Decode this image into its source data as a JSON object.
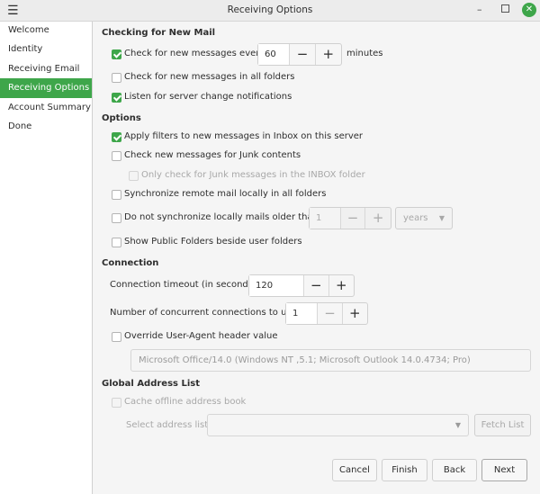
{
  "window": {
    "title": "Receiving Options",
    "close_color": "#3ea64a"
  },
  "sidebar": {
    "items": [
      {
        "label": "Welcome"
      },
      {
        "label": "Identity"
      },
      {
        "label": "Receiving Email"
      },
      {
        "label": "Receiving Options",
        "selected": true
      },
      {
        "label": "Account Summary"
      },
      {
        "label": "Done"
      }
    ]
  },
  "checking": {
    "heading": "Checking for New Mail",
    "every": {
      "label": "Check for new messages every",
      "checked": true,
      "value": "60",
      "unit": "minutes"
    },
    "all_folders": {
      "label": "Check for new messages in all folders",
      "checked": false
    },
    "listen": {
      "label": "Listen for server change notifications",
      "checked": true
    }
  },
  "options": {
    "heading": "Options",
    "filters": {
      "label": "Apply filters to new messages in Inbox on this server",
      "checked": true
    },
    "junk": {
      "label": "Check new messages for Junk contents",
      "checked": false
    },
    "junk_inbox": {
      "label": "Only check for Junk messages in the INBOX folder",
      "checked": false
    },
    "sync": {
      "label": "Synchronize remote mail locally in all folders",
      "checked": false
    },
    "nosync": {
      "label": "Do not synchronize locally mails older than",
      "checked": false,
      "value": "1",
      "unit": "years"
    },
    "public": {
      "label": "Show Public Folders beside user folders",
      "checked": false
    }
  },
  "connection": {
    "heading": "Connection",
    "timeout": {
      "label": "Connection timeout (in seconds)",
      "value": "120"
    },
    "concurrent": {
      "label": "Number of concurrent connections to use",
      "value": "1"
    },
    "override": {
      "label": "Override User-Agent header value",
      "checked": false
    },
    "user_agent": "Microsoft Office/14.0 (Windows NT ,5.1; Microsoft Outlook 14.0.4734; Pro)"
  },
  "gal": {
    "heading": "Global Address List",
    "cache": {
      "label": "Cache offline address book",
      "checked": false
    },
    "select_label": "Select address list:",
    "select_value": "",
    "fetch": "Fetch List"
  },
  "buttons": {
    "cancel": "Cancel",
    "finish": "Finish",
    "back": "Back",
    "next": "Next"
  },
  "symbols": {
    "minus": "−",
    "plus": "+"
  }
}
